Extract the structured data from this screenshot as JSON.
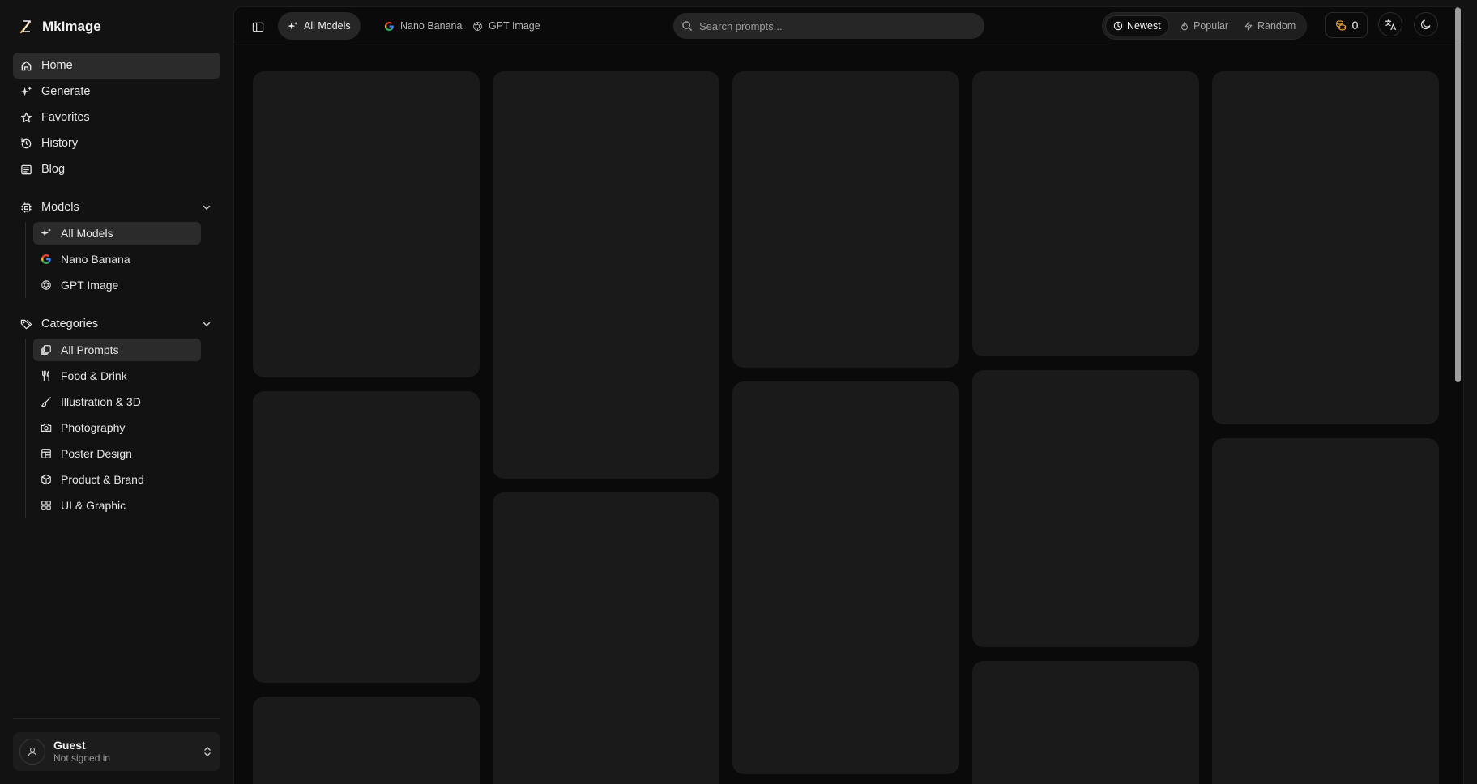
{
  "brand": {
    "name": "MkImage"
  },
  "sidebar": {
    "nav": [
      {
        "label": "Home",
        "icon": "home-icon",
        "active": true
      },
      {
        "label": "Generate",
        "icon": "sparkles-icon",
        "active": false
      },
      {
        "label": "Favorites",
        "icon": "star-icon",
        "active": false
      },
      {
        "label": "History",
        "icon": "history-icon",
        "active": false
      },
      {
        "label": "Blog",
        "icon": "blog-icon",
        "active": false
      }
    ],
    "models": {
      "label": "Models",
      "items": [
        {
          "label": "All Models",
          "icon": "sparkles-icon",
          "active": true
        },
        {
          "label": "Nano Banana",
          "icon": "google-icon",
          "active": false
        },
        {
          "label": "GPT Image",
          "icon": "openai-icon",
          "active": false
        }
      ]
    },
    "categories": {
      "label": "Categories",
      "items": [
        {
          "label": "All Prompts",
          "icon": "stack-icon",
          "active": true
        },
        {
          "label": "Food & Drink",
          "icon": "utensils-icon",
          "active": false
        },
        {
          "label": "Illustration & 3D",
          "icon": "brush-icon",
          "active": false
        },
        {
          "label": "Photography",
          "icon": "camera-icon",
          "active": false
        },
        {
          "label": "Poster Design",
          "icon": "layout-icon",
          "active": false
        },
        {
          "label": "Product & Brand",
          "icon": "box-icon",
          "active": false
        },
        {
          "label": "UI & Graphic",
          "icon": "grid-icon",
          "active": false
        }
      ]
    },
    "user": {
      "name": "Guest",
      "status": "Not signed in"
    }
  },
  "topbar": {
    "model_tabs": [
      {
        "label": "All Models",
        "icon": "sparkles-icon",
        "active": true
      },
      {
        "label": "Nano Banana",
        "icon": "google-icon",
        "active": false
      },
      {
        "label": "GPT Image",
        "icon": "openai-icon",
        "active": false
      }
    ],
    "search": {
      "placeholder": "Search prompts...",
      "value": ""
    },
    "sort": [
      {
        "label": "Newest",
        "icon": "clock-icon",
        "active": true
      },
      {
        "label": "Popular",
        "icon": "flame-icon",
        "active": false
      },
      {
        "label": "Random",
        "icon": "bolt-icon",
        "active": false
      }
    ],
    "credits": "0"
  },
  "colors": {
    "accent_credits": "#e8a33d",
    "google_blue": "#4285F4",
    "google_red": "#EA4335",
    "google_yellow": "#FBBC05",
    "google_green": "#34A853"
  }
}
